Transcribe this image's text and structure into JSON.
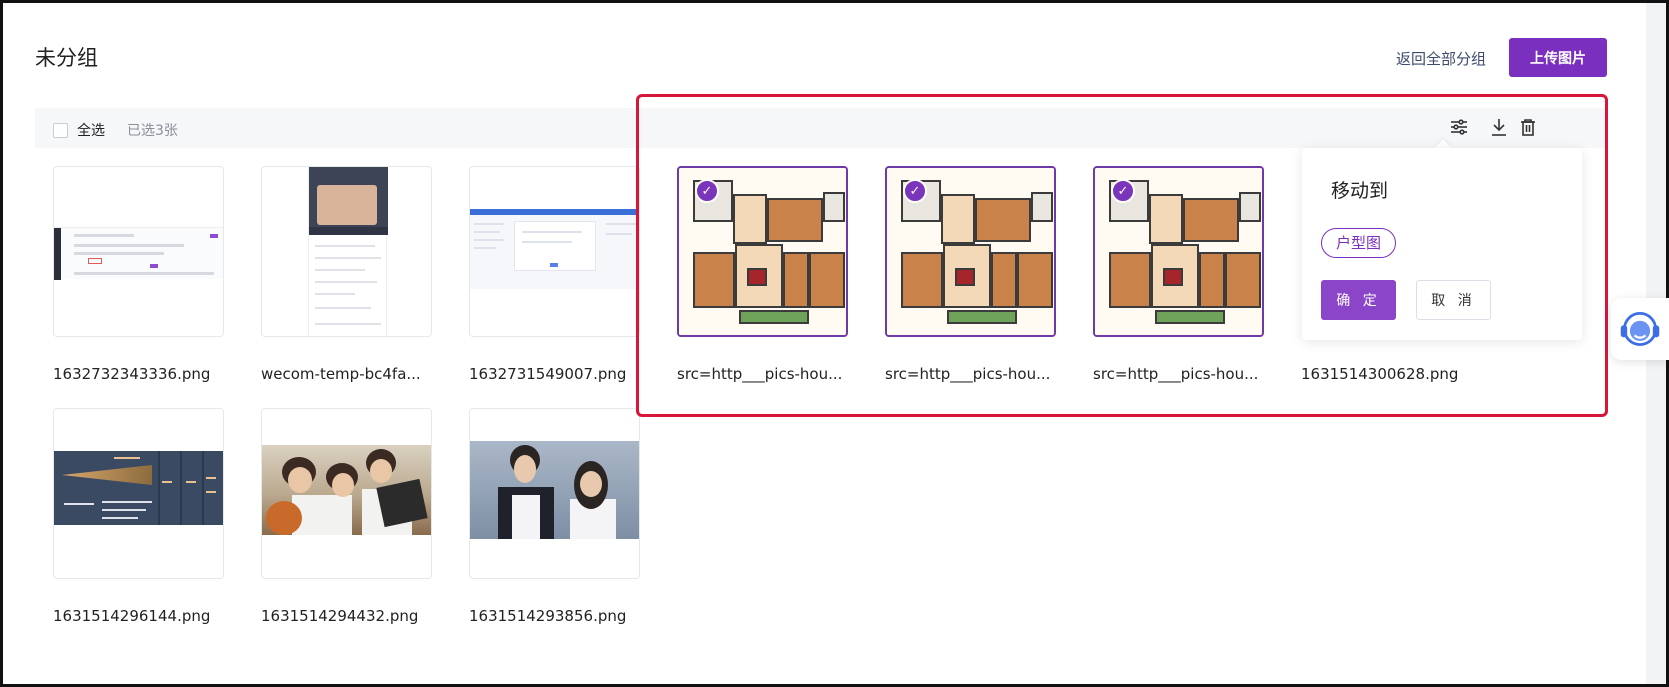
{
  "header": {
    "title": "未分组",
    "back_link": "返回全部分组",
    "upload_button": "上传图片"
  },
  "toolbar": {
    "select_all_label": "全选",
    "selected_count": "已选3张",
    "icons": [
      "sliders-icon",
      "download-icon",
      "trash-icon"
    ]
  },
  "images": [
    {
      "filename": "1632732343336.png",
      "selected": false
    },
    {
      "filename": "wecom-temp-bc4fa...",
      "selected": false
    },
    {
      "filename": "1632731549007.png",
      "selected": false
    },
    {
      "filename": "src=http___pics-hou...",
      "selected": true
    },
    {
      "filename": "src=http___pics-hou...",
      "selected": true
    },
    {
      "filename": "src=http___pics-hou...",
      "selected": true
    },
    {
      "filename": "1631514300628.png",
      "selected": false
    },
    {
      "filename": "1631514296144.png",
      "selected": false
    },
    {
      "filename": "1631514294432.png",
      "selected": false
    },
    {
      "filename": "1631514293856.png",
      "selected": false
    }
  ],
  "move_popover": {
    "title": "移动到",
    "group_tag": "户型图",
    "confirm_button": "确 定",
    "cancel_button": "取 消"
  },
  "colors": {
    "accent": "#7b2fbe",
    "highlight": "#d6173a",
    "check_badge": "#7a35bb"
  },
  "support_icon": "customer-service-icon"
}
